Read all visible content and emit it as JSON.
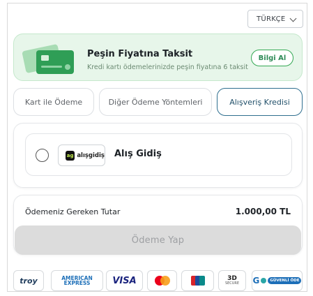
{
  "language_selector": {
    "label": "TÜRKÇE"
  },
  "banner": {
    "title": "Peşin Fiyatına Taksit",
    "subtitle": "Kredi kartı ödemelerinizde peşin fiyatına 6 taksit",
    "button_label": "Bilgi Al"
  },
  "tabs": [
    {
      "label": "Kart ile Ödeme",
      "active": false
    },
    {
      "label": "Diğer Ödeme Yöntemleri",
      "active": false
    },
    {
      "label": "Alışveriş Kredisi",
      "active": true
    }
  ],
  "payment_method": {
    "logo_badge": "ag",
    "logo_text": "alışgidiş",
    "name": "Alış Gidiş",
    "selected": false
  },
  "summary": {
    "label": "Ödemeniz Gereken Tutar",
    "amount": "1.000,00 TL",
    "pay_button_label": "Ödeme Yap"
  },
  "brands": {
    "troy": "troy",
    "amex_line1": "AMERICAN",
    "amex_line2": "EXPRESS",
    "visa": "VISA",
    "threed": "3D",
    "threed_sub": "SECURE",
    "guvenli": "GÜVENLİ ÖDE"
  },
  "colors": {
    "accent_green": "#34a853",
    "banner_bg": "#e7f6ea",
    "active_tab": "#2f6f8f",
    "pay_button_disabled": "#dcdcdc"
  }
}
